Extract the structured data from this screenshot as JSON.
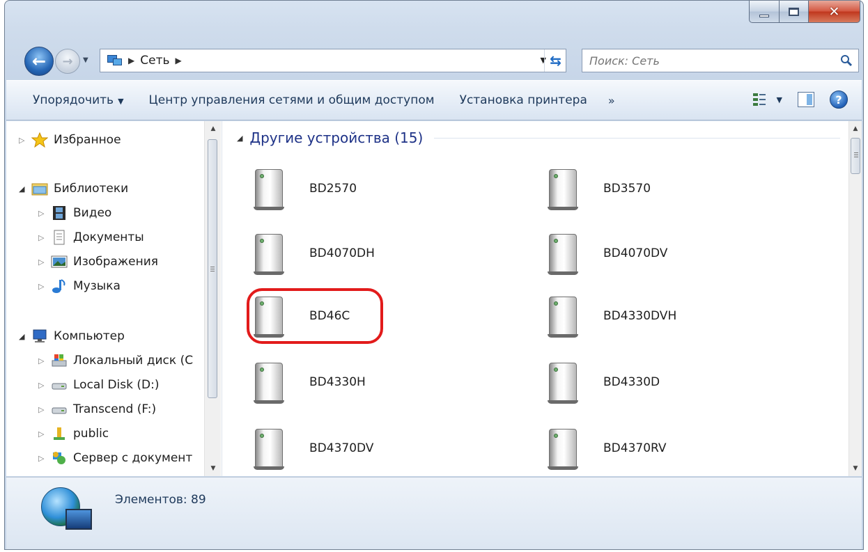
{
  "address": {
    "segments": [
      "Сеть"
    ]
  },
  "search": {
    "placeholder": "Поиск: Сеть"
  },
  "toolbar": {
    "organize": "Упорядочить",
    "network_center": "Центр управления сетями и общим доступом",
    "add_printer": "Установка принтера",
    "more": "»"
  },
  "nav": {
    "favorites": "Избранное",
    "libraries": "Библиотеки",
    "video": "Видео",
    "documents": "Документы",
    "pictures": "Изображения",
    "music": "Музыка",
    "computer": "Компьютер",
    "local_disk_c": "Локальный диск (С",
    "local_disk_d": "Local Disk (D:)",
    "transcend": "Transcend (F:)",
    "public": "public",
    "doc_server": "Сервер с документ"
  },
  "group": {
    "title": "Другие устройства (15)"
  },
  "devices": [
    {
      "label": "BD2570"
    },
    {
      "label": "BD3570"
    },
    {
      "label": "BD4070DH"
    },
    {
      "label": "BD4070DV"
    },
    {
      "label": "BD46C"
    },
    {
      "label": "BD4330DVH"
    },
    {
      "label": "BD4330H"
    },
    {
      "label": "BD4330D"
    },
    {
      "label": "BD4370DV"
    },
    {
      "label": "BD4370RV"
    }
  ],
  "status": {
    "items": "Элементов: 89"
  },
  "colors": {
    "highlight": "#e21b1b",
    "group_title": "#1e3287",
    "command_text": "#1e395b"
  }
}
